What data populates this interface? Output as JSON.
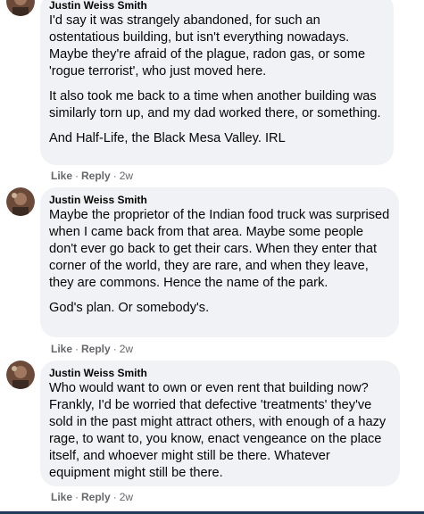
{
  "comments": [
    {
      "author": "Justin Weiss Smith",
      "paragraphs": [
        "I'd say it was strangely abandoned, for such an ostentatious building, but isn't everything nowadays. Maybe they're afraid of the plague, radon gas, or some 'rogue terrorist', who just moved here.",
        "It also took me back to a time when another building was similarly torn up, and my dad worked there, or something.",
        "And Half-Life, the Black Mesa Valley. IRL"
      ],
      "like": "Like",
      "reply": "Reply",
      "time": "2w"
    },
    {
      "author": "Justin Weiss Smith",
      "paragraphs": [
        "Maybe the proprietor of the Indian food truck was surprised when I came back from that area. Maybe some people don't ever go back to get their cars. When they enter that corner of the world, they are rare, and when they leave, they are commons. Hence the name of the park.",
        "God's plan. Or somebody's."
      ],
      "like": "Like",
      "reply": "Reply",
      "time": "2w"
    },
    {
      "author": "Justin Weiss Smith",
      "paragraphs": [
        "Who would want to own or even rent that building now? Frankly, I'd be worried that defective 'treatments' they've sold in the past might attract others, with enough of a hazy rage, to want to, you know, enact vengeance on the place itself, and whoever might still be there. Whatever equipment might still be there."
      ],
      "like": "Like",
      "reply": "Reply",
      "time": "2w"
    }
  ],
  "separator": "·",
  "colors": {
    "bubble": "#f0f2f5",
    "text": "#050505",
    "meta": "#65676b"
  }
}
